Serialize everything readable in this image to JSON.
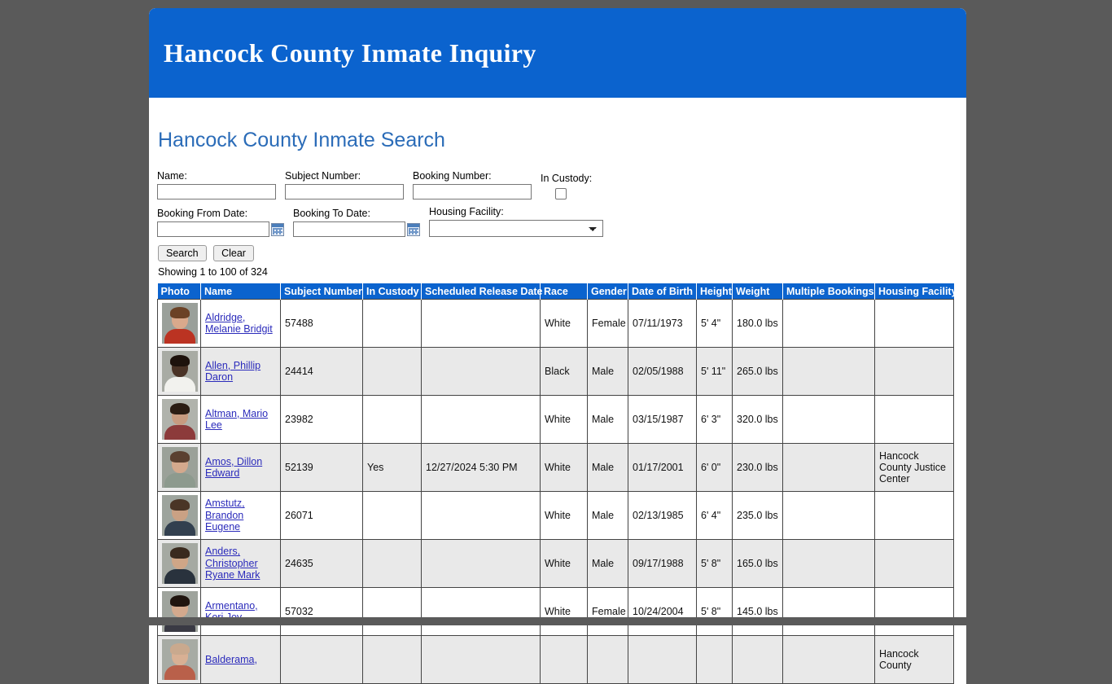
{
  "header": {
    "title": "Hancock County Inmate Inquiry"
  },
  "search": {
    "section_title": "Hancock County Inmate Search",
    "name_label": "Name:",
    "name_value": "",
    "subject_number_label": "Subject Number:",
    "subject_number_value": "",
    "booking_number_label": "Booking Number:",
    "booking_number_value": "",
    "in_custody_label": "In Custody:",
    "in_custody_checked": false,
    "booking_from_label": "Booking From Date:",
    "booking_from_value": "",
    "booking_to_label": "Booking To Date:",
    "booking_to_value": "",
    "housing_facility_label": "Housing Facility:",
    "housing_facility_value": "",
    "search_button": "Search",
    "clear_button": "Clear"
  },
  "results": {
    "showing_text": "Showing 1 to 100 of 324",
    "columns": [
      "Photo",
      "Name",
      "Subject Number",
      "In Custody",
      "Scheduled Release Date",
      "Race",
      "Gender",
      "Date of Birth",
      "Height",
      "Weight",
      "Multiple Bookings",
      "Housing Facility"
    ],
    "rows": [
      {
        "name": "Aldridge, Melanie Bridgit",
        "subject_number": "57488",
        "in_custody": "",
        "scheduled_release_date": "",
        "race": "White",
        "gender": "Female",
        "date_of_birth": "07/11/1973",
        "height": "5' 4\"",
        "weight": "180.0 lbs",
        "multiple_bookings": "",
        "housing_facility": "",
        "photo": {
          "skin": "#d9a98c",
          "hair": "#6b4226",
          "shirt": "#bb3322",
          "bg": "#9aa09a"
        }
      },
      {
        "name": "Allen, Phillip Daron",
        "subject_number": "24414",
        "in_custody": "",
        "scheduled_release_date": "",
        "race": "Black",
        "gender": "Male",
        "date_of_birth": "02/05/1988",
        "height": "5' 11\"",
        "weight": "265.0 lbs",
        "multiple_bookings": "",
        "housing_facility": "",
        "photo": {
          "skin": "#4a3326",
          "hair": "#1d120c",
          "shirt": "#f2f2ee",
          "bg": "#a8aba4"
        }
      },
      {
        "name": "Altman, Mario Lee",
        "subject_number": "23982",
        "in_custody": "",
        "scheduled_release_date": "",
        "race": "White",
        "gender": "Male",
        "date_of_birth": "03/15/1987",
        "height": "6' 3\"",
        "weight": "320.0 lbs",
        "multiple_bookings": "",
        "housing_facility": "",
        "photo": {
          "skin": "#c79b80",
          "hair": "#2b1d14",
          "shirt": "#8c3b3b",
          "bg": "#b0b3ac"
        }
      },
      {
        "name": "Amos, Dillon Edward",
        "subject_number": "52139",
        "in_custody": "Yes",
        "scheduled_release_date": "12/27/2024 5:30 PM",
        "race": "White",
        "gender": "Male",
        "date_of_birth": "01/17/2001",
        "height": "6' 0\"",
        "weight": "230.0 lbs",
        "multiple_bookings": "",
        "housing_facility": "Hancock County Justice Center",
        "photo": {
          "skin": "#d4a98d",
          "hair": "#5a4030",
          "shirt": "#8d9a8e",
          "bg": "#9ba199"
        }
      },
      {
        "name": "Amstutz, Brandon Eugene",
        "subject_number": "26071",
        "in_custody": "",
        "scheduled_release_date": "",
        "race": "White",
        "gender": "Male",
        "date_of_birth": "02/13/1985",
        "height": "6' 4\"",
        "weight": "235.0 lbs",
        "multiple_bookings": "",
        "housing_facility": "",
        "photo": {
          "skin": "#caa184",
          "hair": "#4a3526",
          "shirt": "#32404f",
          "bg": "#9da49d"
        }
      },
      {
        "name": "Anders, Christopher Ryane Mark",
        "subject_number": "24635",
        "in_custody": "",
        "scheduled_release_date": "",
        "race": "White",
        "gender": "Male",
        "date_of_birth": "09/17/1988",
        "height": "5' 8\"",
        "weight": "165.0 lbs",
        "multiple_bookings": "",
        "housing_facility": "",
        "photo": {
          "skin": "#cfa687",
          "hair": "#3a2a1e",
          "shirt": "#29323d",
          "bg": "#a5a9a2"
        }
      },
      {
        "name": "Armentano, Kori Joy",
        "subject_number": "57032",
        "in_custody": "",
        "scheduled_release_date": "",
        "race": "White",
        "gender": "Female",
        "date_of_birth": "10/24/2004",
        "height": "5' 8\"",
        "weight": "145.0 lbs",
        "multiple_bookings": "",
        "housing_facility": "",
        "photo": {
          "skin": "#d3a98d",
          "hair": "#20150f",
          "shirt": "#3a3a44",
          "bg": "#9fa49d"
        }
      },
      {
        "name": "Balderama,",
        "subject_number": "",
        "in_custody": "",
        "scheduled_release_date": "",
        "race": "",
        "gender": "",
        "date_of_birth": "",
        "height": "",
        "weight": "",
        "multiple_bookings": "",
        "housing_facility": "Hancock County",
        "photo": {
          "skin": "#d8b094",
          "hair": "#c9a98e",
          "shirt": "#b9604a",
          "bg": "#a7aba4"
        }
      }
    ]
  }
}
